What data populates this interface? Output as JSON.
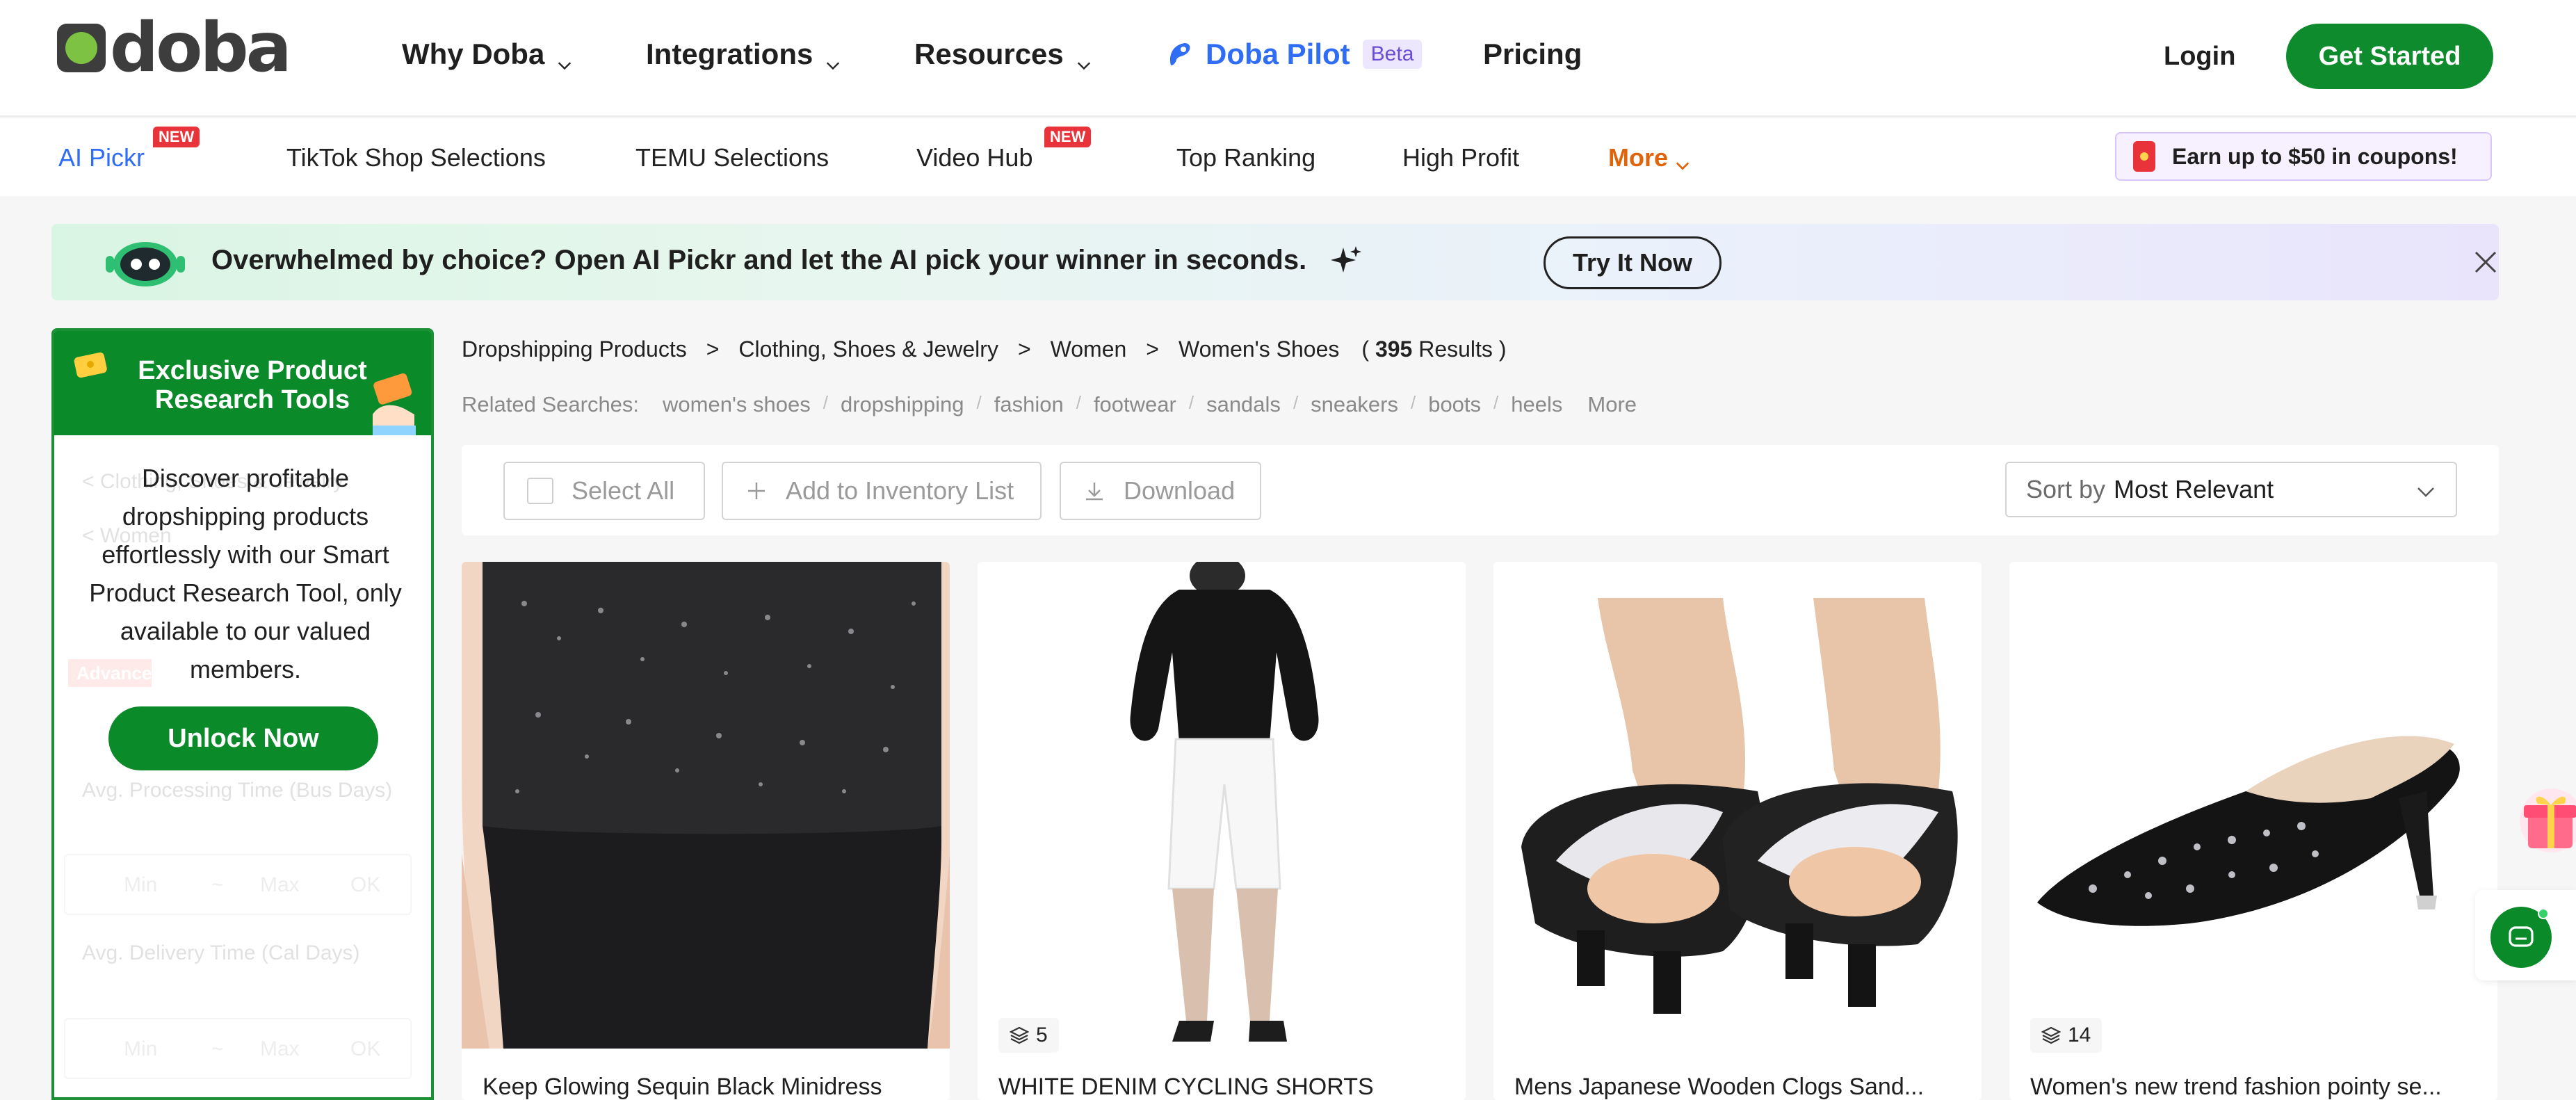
{
  "brand": {
    "name": "doba"
  },
  "topnav": {
    "items": [
      "Why Doba",
      "Integrations",
      "Resources"
    ],
    "pilot_label": "Doba Pilot",
    "pilot_badge": "Beta",
    "pricing": "Pricing",
    "login": "Login",
    "get_started": "Get Started"
  },
  "subnav": {
    "items": [
      "AI Pickr",
      "TikTok Shop Selections",
      "TEMU Selections",
      "Video Hub",
      "Top Ranking",
      "High Profit",
      "More"
    ],
    "new_badge": "NEW",
    "coupon": "Earn up to $50 in coupons!"
  },
  "banner": {
    "text": "Overwhelmed by choice? Open AI Pickr and let the AI pick your winner in seconds.",
    "button": "Try It Now"
  },
  "sidebar": {
    "title": "Exclusive Product Research Tools",
    "description": "Discover profitable dropshipping products effortlessly with our Smart Product Research Tool, only available to our valued members.",
    "unlock": "Unlock Now",
    "ghost": {
      "back1": "< Clothing, Shoes & Jewelry",
      "back2": "< Women",
      "advanced": "Advanced",
      "proc_label": "Avg. Processing Time (Bus Days)",
      "deliv_label": "Avg. Delivery Time (Cal Days)",
      "min": "Min",
      "max": "Max",
      "dash": "~",
      "ok": "OK"
    }
  },
  "breadcrumb": {
    "items": [
      "Dropshipping Products",
      "Clothing, Shoes & Jewelry",
      "Women",
      "Women's Shoes"
    ],
    "separator": ">",
    "results_open": "(",
    "results_count": "395",
    "results_label": "Results )"
  },
  "related": {
    "label": "Related Searches:",
    "tags": [
      "women's shoes",
      "dropshipping",
      "fashion",
      "footwear",
      "sandals",
      "sneakers",
      "boots",
      "heels"
    ],
    "separator": "/",
    "more": "More"
  },
  "toolbar": {
    "select_all": "Select All",
    "add_inventory": "Add to Inventory List",
    "download": "Download",
    "sort_label": "Sort by",
    "sort_value": "Most Relevant"
  },
  "products": [
    {
      "title": "Keep Glowing Sequin Black Minidress",
      "variants": ""
    },
    {
      "title": "WHITE DENIM CYCLING SHORTS",
      "variants": "5"
    },
    {
      "title": "Mens Japanese Wooden Clogs Sand...",
      "variants": ""
    },
    {
      "title": "Women's new trend fashion pointy se...",
      "variants": "14"
    }
  ],
  "colors": {
    "brand_green": "#0b8a2a",
    "accent_blue": "#2f6df5",
    "more_orange": "#e0640a",
    "new_red": "#e8333a"
  }
}
